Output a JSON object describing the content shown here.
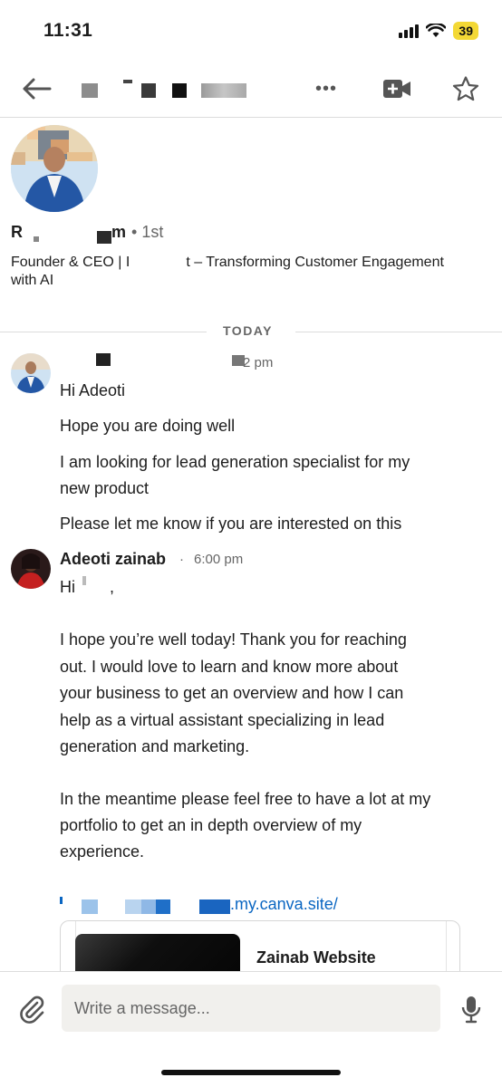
{
  "status_bar": {
    "time": "11:31",
    "battery": "39"
  },
  "header": {
    "more_label": "•••"
  },
  "profile": {
    "name_start": "R",
    "name_end": "m",
    "degree": "• 1st",
    "headline_line1": "Founder & CEO | I",
    "headline_line1_end": "t – Transforming Customer Engagement",
    "headline_line2": "with AI"
  },
  "divider": {
    "label": "TODAY"
  },
  "messages": [
    {
      "time_fragment": "2 pm",
      "lines": [
        "Hi Adeoti",
        "Hope you are doing well",
        "I am looking for lead generation specialist for my",
        "new product",
        "Please let me know if you are interested on this"
      ]
    },
    {
      "sender": "Adeoti zainab",
      "separator": "·",
      "time": "6:00 pm",
      "greeting": "Hi",
      "greeting_end": ",",
      "lines": [
        "I hope you’re well today! Thank you for reaching",
        "out. I would love to learn and know more about",
        "your business to get an overview and how I can",
        "help as a virtual assistant specializing in lead",
        "generation and marketing.",
        "In the meantime please feel free to have a lot at my",
        "portfolio to get an in depth overview of my",
        "experience."
      ],
      "link_text": ".my.canva.site/",
      "preview_title": "Zainab Website"
    }
  ],
  "composer": {
    "placeholder": "Write a message..."
  },
  "colors": {
    "link": "#0a66c2",
    "battery": "#f3d835",
    "input_bg": "#f1f0ed"
  }
}
